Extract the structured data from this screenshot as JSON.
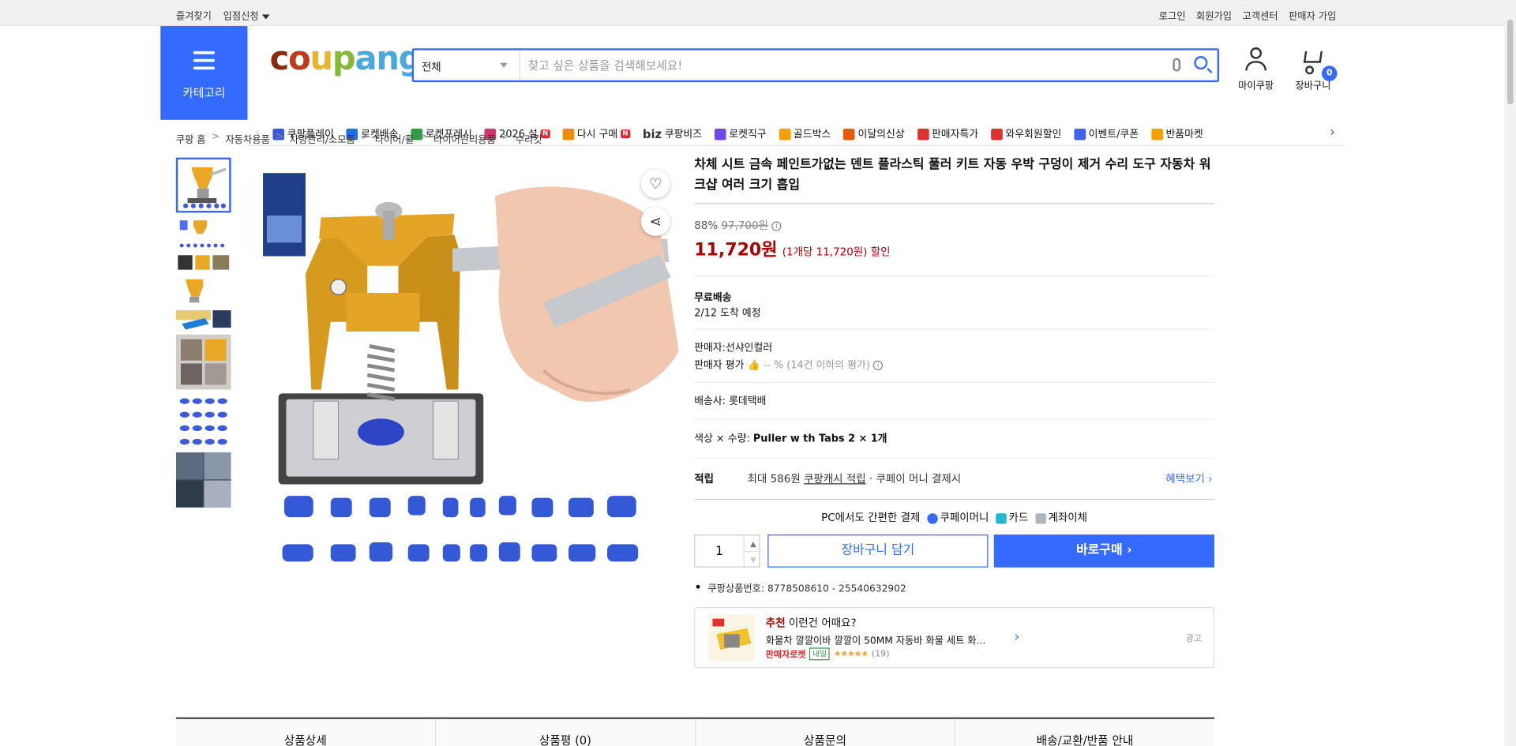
{
  "topbar": {
    "favorites": "즐겨찾기",
    "store_apply": "입점신청",
    "login": "로그인",
    "signup": "회원가입",
    "service_center": "고객센터",
    "seller_signup": "판매자 가입"
  },
  "header": {
    "category_label": "카테고리",
    "logo": [
      "c",
      "o",
      "u",
      "p",
      "a",
      "n",
      "g"
    ],
    "search_category": "전체",
    "search_placeholder": "찾고 싶은 상품을 검색해보세요!",
    "my_coupang": "마이쿠팡",
    "cart_label": "장바구니",
    "cart_count": "0"
  },
  "nav": [
    {
      "label": "쿠팡플레이",
      "icon": "play-icon",
      "color": "#3b5bdb"
    },
    {
      "label": "로켓배송",
      "icon": "rocket-icon",
      "color": "#1f6feb"
    },
    {
      "label": "로켓프레시",
      "icon": "rocket-fresh-icon",
      "color": "#2f9e44"
    },
    {
      "label": "2026 설",
      "icon": "gift-icon",
      "color": "#d6336c",
      "badge": "N"
    },
    {
      "label": "다시 구매",
      "icon": "house-icon",
      "color": "#f08c00",
      "badge": "N"
    },
    {
      "label": "쿠팡비즈",
      "icon": "biz-icon",
      "color": "#333333",
      "prefix": "biz"
    },
    {
      "label": "로켓직구",
      "icon": "globe-icon",
      "color": "#7048e8"
    },
    {
      "label": "골드박스",
      "icon": "goldbox-icon",
      "color": "#f59f00"
    },
    {
      "label": "이달의신상",
      "icon": "new-bag-icon",
      "color": "#e8590c"
    },
    {
      "label": "판매자특가",
      "icon": "percent-icon",
      "color": "#e03131"
    },
    {
      "label": "와우회원할인",
      "icon": "wow-icon",
      "color": "#e03131"
    },
    {
      "label": "이벤트/쿠폰",
      "icon": "coupon-icon",
      "color": "#4263eb"
    },
    {
      "label": "반품마켓",
      "icon": "return-market-icon",
      "color": "#f59f00"
    }
  ],
  "breadcrumb": [
    "쿠팡 홈",
    "자동차용품",
    "차량관리/소모품",
    "타이어/휠",
    "타이어관리용품",
    "수리킷"
  ],
  "product": {
    "title": "차체 시트 금속 페인트가없는 덴트 플라스틱 풀러 키트 자동 우박 구덩이 제거 수리 도구 자동차 워크샵 여러 크기 흡입",
    "discount_rate": "88%",
    "original_price": "97,700원",
    "sale_price": "11,720원",
    "unit_price": "(1개당 11,720원) 할인",
    "shipping_type": "무료배송",
    "arrival": "2/12 도착 예정",
    "seller": "판매자:선샤인컬러",
    "seller_rating_label": "판매자 평가",
    "seller_rating_value": "-- % (14건 이하의 평가)",
    "carrier": "배송사:  롯데택배",
    "option_label": "색상 × 수량: ",
    "option_value": "Puller w th Tabs 2 × 1개",
    "reward_label": "적립",
    "reward_text_a": "최대 586원 ",
    "reward_text_link": "쿠팡캐시 적립",
    "reward_text_b": " · 쿠페이 머니 결제시",
    "benefit_link": "혜택보기 ›",
    "pay_intro": "PC에서도 간편한 결제",
    "pay_options": [
      "쿠페이머니",
      "카드",
      "계좌이체"
    ],
    "quantity": "1",
    "cart_button": "장바구니 담기",
    "buy_button": "바로구매 ›",
    "product_number": "쿠팡상품번호: 8778508610 - 25540632902"
  },
  "recommend": {
    "tag": "추천",
    "heading": " 이런건 어때요?",
    "name": "화물차 깔깔이바 깔깔이 50MM 자동바 화물 세트 화...",
    "seller_badge": "판매자로켓",
    "tomorrow": "내일",
    "stars": "★★★★★",
    "rating": 4.5,
    "review_count": "(19)",
    "ad_label": "광고"
  },
  "tabs": [
    "상품상세",
    "상품평 (0)",
    "상품문의",
    "배송/교환/반품 안내"
  ]
}
